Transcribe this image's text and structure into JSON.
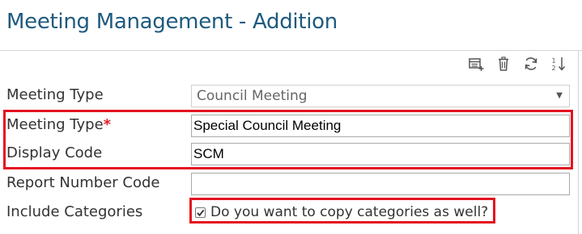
{
  "page": {
    "title": "Meeting Management - Addition"
  },
  "toolbar": {
    "icons": [
      "add-record-icon",
      "delete-icon",
      "refresh-icon",
      "sort-icon"
    ]
  },
  "form": {
    "meeting_type_select": {
      "label": "Meeting Type",
      "value": "Council Meeting"
    },
    "meeting_type_name": {
      "label": "Meeting Type",
      "required_marker": "*",
      "value": "Special Council Meeting"
    },
    "display_code": {
      "label": "Display Code",
      "value": "SCM"
    },
    "report_number_code": {
      "label": "Report Number Code",
      "value": ""
    },
    "include_categories": {
      "label": "Include Categories",
      "checkbox_text": "Do you want to copy categories as well?",
      "checked": true
    }
  },
  "colors": {
    "title": "#1e5a7e",
    "highlight": "#e4121f",
    "required": "#e41e2b"
  }
}
